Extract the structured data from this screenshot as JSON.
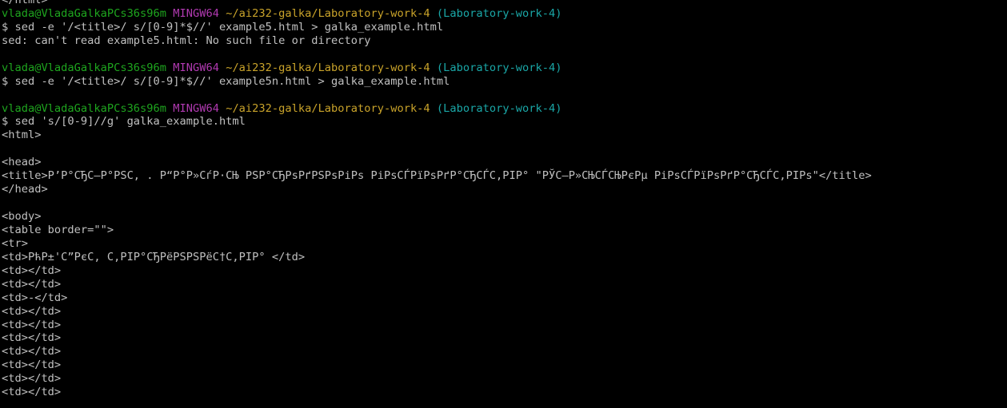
{
  "prompt": {
    "user": "vlada@VladaGalkaPCs36s96m",
    "env": "MINGW64",
    "path": "~/ai232-galka/Laboratory-work-4",
    "branch": "(Laboratory-work-4)"
  },
  "lines": [
    {
      "type": "text",
      "text": "</html>"
    },
    {
      "type": "prompt"
    },
    {
      "type": "text",
      "text": "$ sed -e '/<title>/ s/[0-9]*$//' example5.html > galka_example.html"
    },
    {
      "type": "text",
      "text": "sed: can't read example5.html: No such file or directory"
    },
    {
      "type": "text",
      "text": ""
    },
    {
      "type": "prompt"
    },
    {
      "type": "text",
      "text": "$ sed -e '/<title>/ s/[0-9]*$//' example5n.html > galka_example.html"
    },
    {
      "type": "text",
      "text": ""
    },
    {
      "type": "prompt"
    },
    {
      "type": "text",
      "text": "$ sed 's/[0-9]//g' galka_example.html"
    },
    {
      "type": "text",
      "text": "<html>"
    },
    {
      "type": "text",
      "text": ""
    },
    {
      "type": "text",
      "text": "<head>"
    },
    {
      "type": "text",
      "text": "<title>Р’Р°СЂС–Р°РЅС‚ . Р“Р°Р»СѓР·СЊ РЅР°СЂРѕРґРЅРѕРіРѕ РіРѕСЃРїРѕРґР°СЂСЃС‚РІР° \"РЎС–Р»СЊСЃСЊРєРµ РіРѕСЃРїРѕРґР°СЂСЃС‚РІРѕ\"</title>"
    },
    {
      "type": "text",
      "text": "</head>"
    },
    {
      "type": "text",
      "text": ""
    },
    {
      "type": "text",
      "text": "<body>"
    },
    {
      "type": "text",
      "text": "<table border=\"\">"
    },
    {
      "type": "text",
      "text": "<tr>"
    },
    {
      "type": "text",
      "text": "<td>РћР±'С”РєС‚ С‚РІР°СЂРёРЅРЅРёС†С‚РІР° </td>"
    },
    {
      "type": "text",
      "text": "<td></td>"
    },
    {
      "type": "text",
      "text": "<td></td>"
    },
    {
      "type": "text",
      "text": "<td>-</td>"
    },
    {
      "type": "text",
      "text": "<td></td>"
    },
    {
      "type": "text",
      "text": "<td></td>"
    },
    {
      "type": "text",
      "text": "<td></td>"
    },
    {
      "type": "text",
      "text": "<td></td>"
    },
    {
      "type": "text",
      "text": "<td></td>"
    },
    {
      "type": "text",
      "text": "<td></td>"
    },
    {
      "type": "text",
      "text": "<td></td>"
    }
  ]
}
